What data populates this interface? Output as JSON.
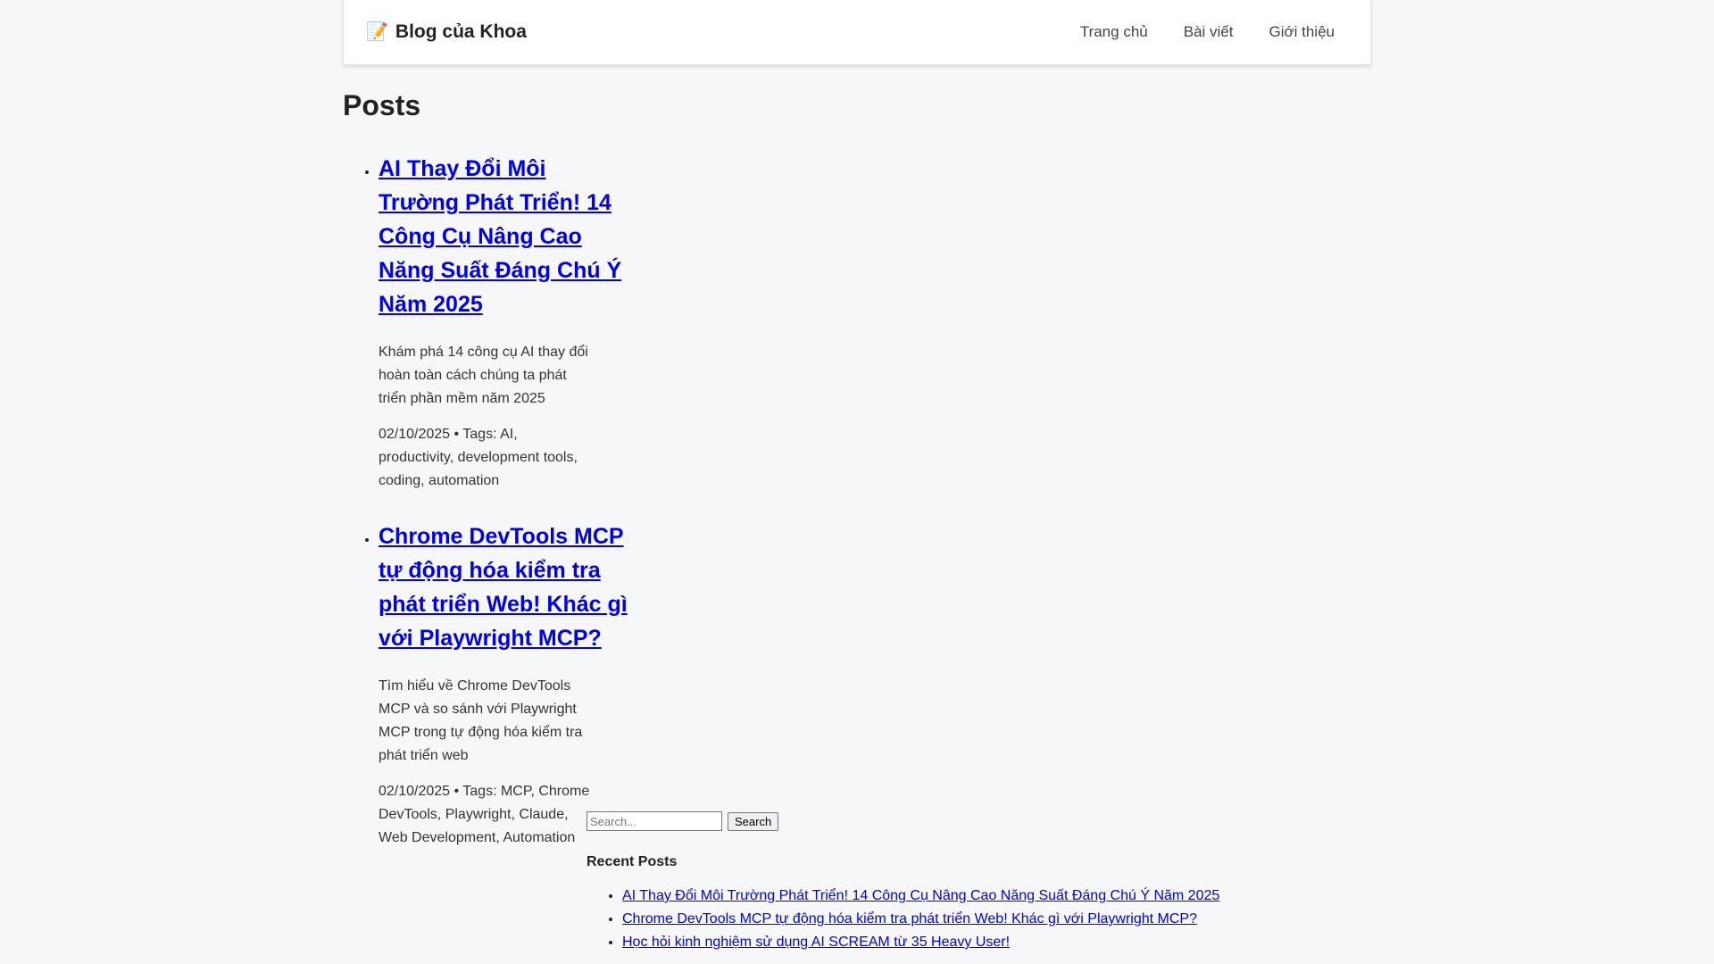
{
  "header": {
    "brand_icon": "memo-icon",
    "brand_icon_glyph": "📝",
    "brand": "Blog của Khoa",
    "nav": [
      "Trang chủ",
      "Bài viết",
      "Giới thiệu"
    ]
  },
  "page": {
    "title": "Posts"
  },
  "posts": [
    {
      "title": "AI Thay Đổi Môi Trường Phát Triển! 14 Công Cụ Nâng Cao Năng Suất Đáng Chú Ý Năm 2025",
      "description": "Khám phá 14 công cụ AI thay đổi hoàn toàn cách chúng ta phát triển phần mềm năm 2025",
      "meta": "02/10/2025 • Tags: AI, productivity, development tools, coding, automation"
    },
    {
      "title": "Chrome DevTools MCP tự động hóa kiểm tra phát triển Web! Khác gì với Playwright MCP?",
      "description": "Tìm hiểu về Chrome DevTools MCP và so sánh với Playwright MCP trong tự động hóa kiểm tra phát triển web",
      "meta": "02/10/2025 • Tags: MCP, Chrome DevTools, Playwright, Claude, Web Development, Automation"
    }
  ],
  "sidebar": {
    "search_placeholder": "Search...",
    "search_button": "Search",
    "recent_heading": "Recent Posts",
    "recent": [
      "AI Thay Đổi Môi Trường Phát Triển! 14 Công Cụ Nâng Cao Năng Suất Đáng Chú Ý Năm 2025",
      "Chrome DevTools MCP tự động hóa kiểm tra phát triển Web! Khác gì với Playwright MCP?",
      "Học hỏi kinh nghiệm sử dụng AI SCREAM từ 35 Heavy User!"
    ]
  },
  "colors": {
    "link": "#0000ee",
    "background": "#f6f7f9",
    "header_bg": "#ffffff"
  }
}
